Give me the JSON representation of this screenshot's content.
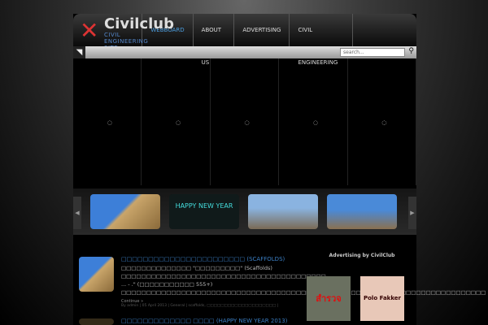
{
  "logo": {
    "title": "Civilclub",
    "subtitle": "CIVIL ENGINEERING SITE"
  },
  "nav": [
    "WEBBOARD",
    "ABOUT US",
    "ADVERTISING",
    "CIVIL ENGINEERING"
  ],
  "search": {
    "placeholder": "search..."
  },
  "thumbnails": [
    {
      "label": "scaffolds"
    },
    {
      "label": "HAPPY NEW YEAR"
    },
    {
      "label": "construction"
    },
    {
      "label": "construction"
    }
  ],
  "posts": [
    {
      "title": "□□□□□□□□□□□□□□□□□□□□□□□",
      "tag": "(SCAFFOLDS)",
      "body": "□□□□□□□□□□□□□□ \"□□□□□□□□□\" (Scaffolds) □□□□□□□□□□□□□□□□□□□□□□□□□□□□□□□□□□□□□□□□□ ... - .\" (□□□□□□□□□□□ 555+) □□□□□□□□□□□□□□□□□□□□□□□□□□□□□□□□□□□□□□□□□□□□□□□□□□□□□□□□□□□□□□□□□□□□□□□□□",
      "more": "Continue »",
      "meta": "By admin | 05 April 2013 | General | scaffolds, □□□□□□□□□□□□□□□□□□□□ |"
    },
    {
      "title": "□□□□□□□□□□□□□ □□□□",
      "tag": "(HAPPY NEW YEAR 2013)"
    }
  ],
  "sidebar": {
    "ad_title": "Advertising by CivilClub",
    "ads": [
      "สำรวจ",
      "Polo Fakker"
    ]
  }
}
